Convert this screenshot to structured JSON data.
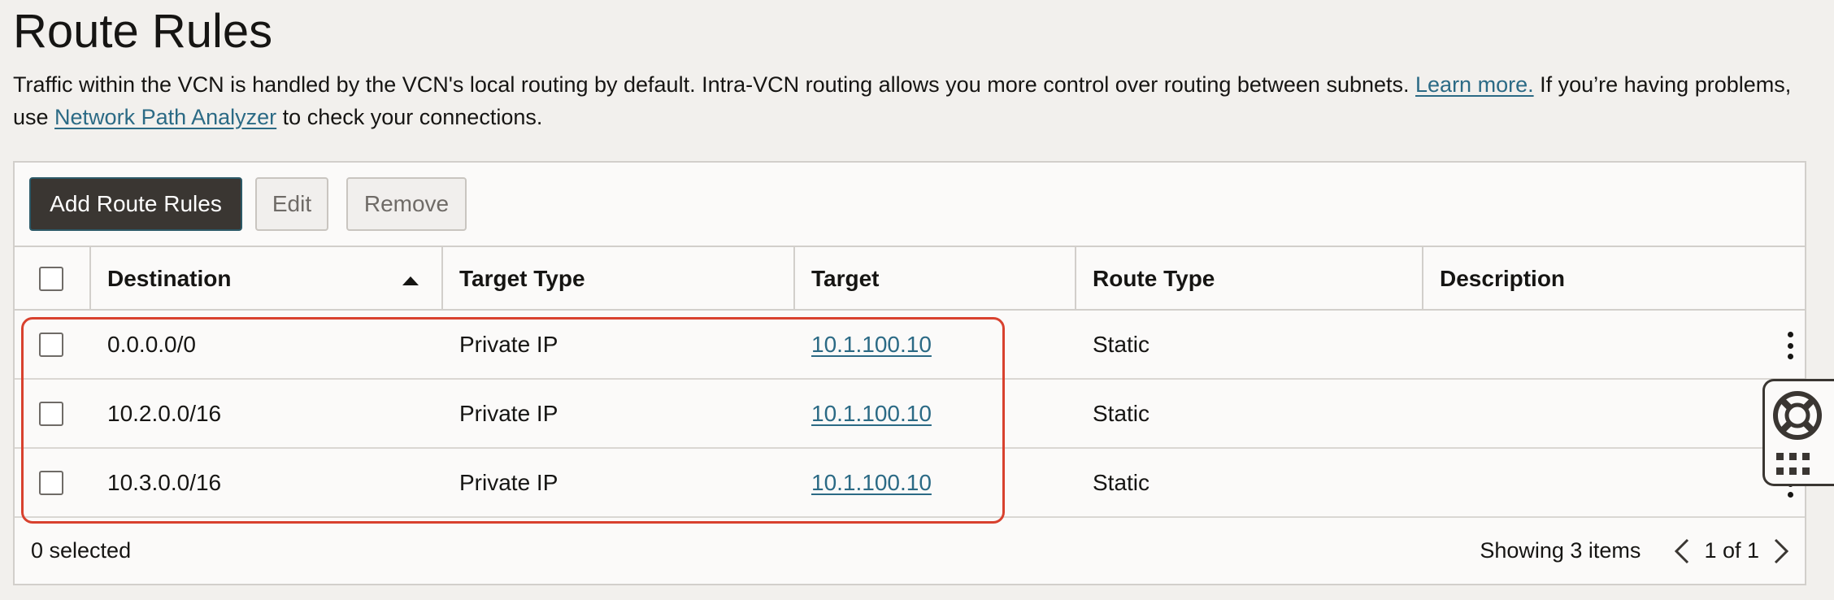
{
  "page": {
    "title": "Route Rules",
    "intro_text_1": "Traffic within the VCN is handled by the VCN's local routing by default. Intra-VCN routing allows you more control over routing between subnets. ",
    "learn_more_link": "Learn more.",
    "intro_text_2": " If you’re having problems, use ",
    "network_path_analyzer_link": "Network Path Analyzer",
    "intro_text_3": " to check your connections."
  },
  "toolbar": {
    "add_label": "Add Route Rules",
    "edit_label": "Edit",
    "remove_label": "Remove"
  },
  "table": {
    "columns": {
      "destination": "Destination",
      "target_type": "Target Type",
      "target": "Target",
      "route_type": "Route Type",
      "description": "Description"
    },
    "sort": {
      "column": "destination",
      "direction": "ascending"
    },
    "rows": [
      {
        "destination": "0.0.0.0/0",
        "target_type": "Private IP",
        "target": "10.1.100.10",
        "route_type": "Static",
        "description": ""
      },
      {
        "destination": "10.2.0.0/16",
        "target_type": "Private IP",
        "target": "10.1.100.10",
        "route_type": "Static",
        "description": ""
      },
      {
        "destination": "10.3.0.0/16",
        "target_type": "Private IP",
        "target": "10.1.100.10",
        "route_type": "Static",
        "description": ""
      }
    ]
  },
  "footer": {
    "selected_text": "0 selected",
    "showing_text": "Showing 3 items",
    "page_text": "1 of 1"
  },
  "icons": {
    "sort": "sort-ascending-icon",
    "row_actions": "kebab-menu-icon",
    "pager_prev": "chevron-left-icon",
    "pager_next": "chevron-right-icon",
    "help": "lifebuoy-icon",
    "apps": "apps-grid-icon"
  },
  "colors": {
    "primary_button": "#3a3632",
    "link": "#2b6a85",
    "highlight_annotation": "#d8412e",
    "background": "#f2f0ed"
  }
}
